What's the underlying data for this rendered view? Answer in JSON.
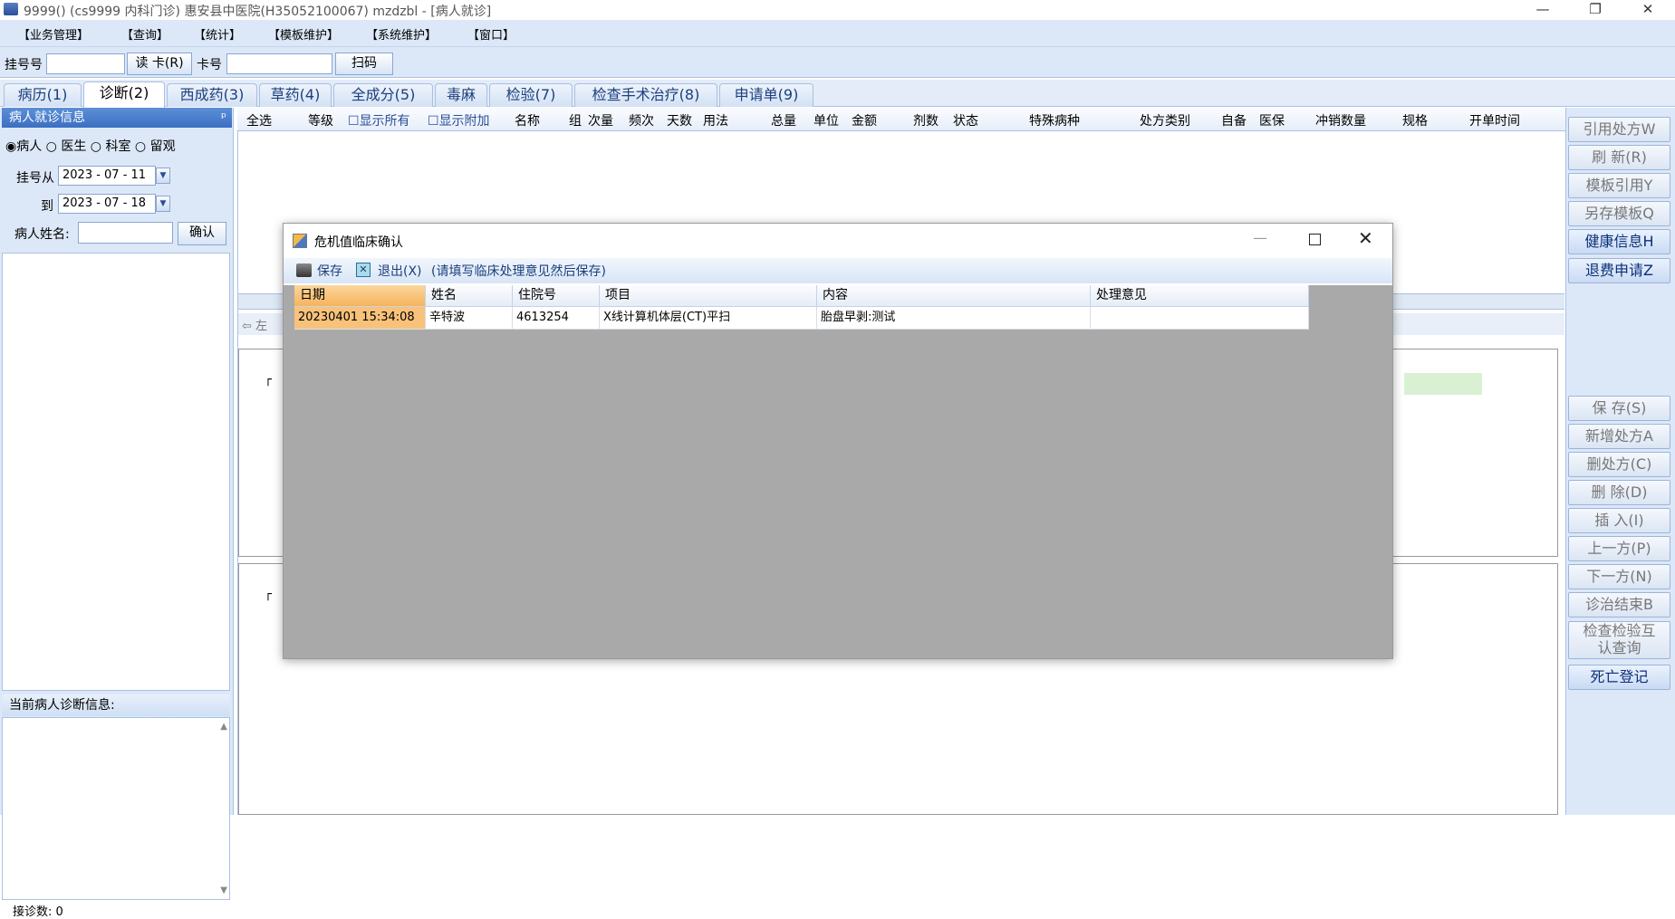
{
  "window": {
    "title": "9999() (cs9999 内科门诊) 惠安县中医院(H35052100067) mzdzbl - [病人就诊]",
    "minimize": "—",
    "maximize": "❐",
    "close": "✕"
  },
  "menu": [
    "【业务管理】",
    "【查询】",
    "【统计】",
    "【模板维护】",
    "【系统维护】",
    "【窗口】"
  ],
  "toolbar": {
    "reg_label": "挂号号",
    "read_card": "读 卡(R)",
    "card_label": "卡号",
    "scan": "扫码"
  },
  "tabs": [
    "病历(1)",
    "诊断(2)",
    "西成药(3)",
    "草药(4)",
    "全成分(5)",
    "毒麻",
    "检验(7)",
    "检查手术治疗(8)",
    "申请单(9)"
  ],
  "left": {
    "header": "病人就诊信息",
    "pin": "ᵖ",
    "radio": [
      "病人",
      "医生",
      "科室",
      "留观"
    ],
    "reg_from": "挂号从",
    "date_from": "2023 - 07 - 11",
    "to": "到",
    "date_to": "2023 - 07 - 18",
    "patient_name": "病人姓名:",
    "confirm": "确认",
    "diag_header": "当前病人诊断信息:",
    "count": "接诊数: 0"
  },
  "grid": {
    "headers": [
      "全选",
      "等级",
      "显示所有",
      "显示附加",
      "名称",
      "组",
      "次量",
      "频次",
      "天数",
      "用法",
      "总量",
      "单位",
      "金额",
      "剂数",
      "状态",
      "特殊病种",
      "处方类别",
      "自备",
      "医保",
      "冲销数量",
      "规格",
      "开单时间"
    ],
    "left_text": "左"
  },
  "right_buttons": [
    {
      "label": "引用处方W",
      "on": false
    },
    {
      "label": "刷 新(R)",
      "on": false
    },
    {
      "label": "模板引用Y",
      "on": false
    },
    {
      "label": "另存模板Q",
      "on": false
    },
    {
      "label": "健康信息H",
      "on": true
    },
    {
      "label": "退费申请Z",
      "on": true
    },
    {
      "label": "保 存(S)",
      "on": false
    },
    {
      "label": "新增处方A",
      "on": false
    },
    {
      "label": "删处方(C)",
      "on": false
    },
    {
      "label": "删 除(D)",
      "on": false
    },
    {
      "label": "插 入(I)",
      "on": false
    },
    {
      "label": "上一方(P)",
      "on": false
    },
    {
      "label": "下一方(N)",
      "on": false
    },
    {
      "label": "诊治结束B",
      "on": false
    },
    {
      "label": "检查检验互\n认查询",
      "on": false
    },
    {
      "label": "死亡登记",
      "on": true
    }
  ],
  "dialog": {
    "title": "危机值临床确认",
    "save": "保存",
    "exit": "退出(X)",
    "hint": "(请填写临床处理意见然后保存)",
    "columns": [
      "日期",
      "姓名",
      "住院号",
      "项目",
      "内容",
      "处理意见"
    ],
    "rows": [
      [
        "20230401 15:34:08",
        "辛特波",
        "4613254",
        "X线计算机体层(CT)平扫",
        "胎盘早剥:测试",
        ""
      ]
    ]
  },
  "colors": {
    "accent": "#3b6fc2",
    "panel_bg": "#dce8f8",
    "selected_cell": "#f9c27a"
  }
}
